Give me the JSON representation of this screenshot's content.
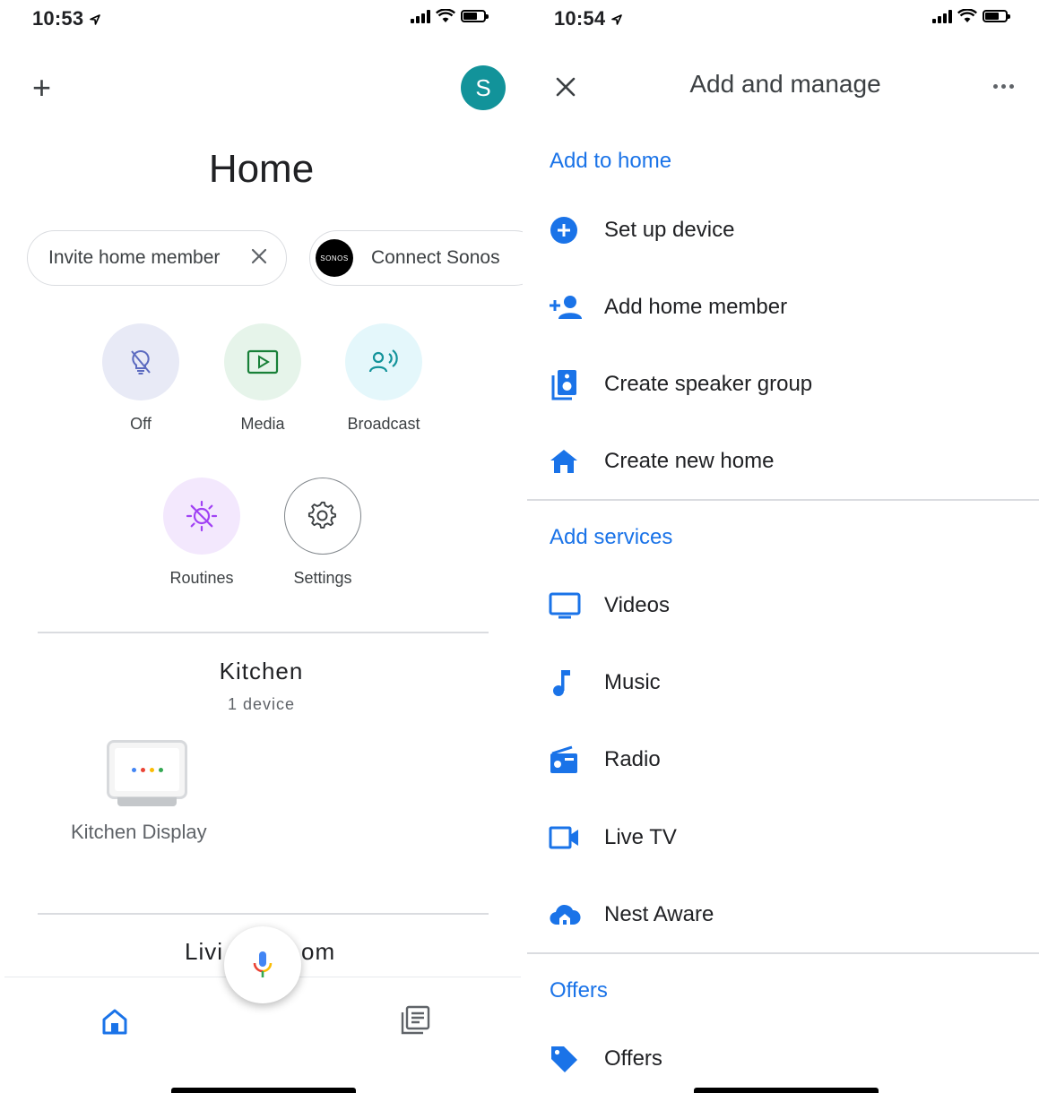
{
  "left": {
    "status": {
      "time": "10:53"
    },
    "avatar_letter": "S",
    "title": "Home",
    "chips": {
      "invite": "Invite home member",
      "sonos_logo": "SONOS",
      "sonos": "Connect Sonos"
    },
    "actions": {
      "off": "Off",
      "media": "Media",
      "broadcast": "Broadcast",
      "routines": "Routines",
      "settings": "Settings"
    },
    "room": {
      "name": "Kitchen",
      "count": "1 device",
      "device_name": "Kitchen Display"
    },
    "next_room": {
      "visible_left": "Livi",
      "visible_right": "om"
    }
  },
  "right": {
    "status": {
      "time": "10:54"
    },
    "title": "Add and manage",
    "sections": {
      "add_to_home": "Add to home",
      "add_services": "Add services",
      "offers": "Offers"
    },
    "items": {
      "setup_device": "Set up device",
      "add_member": "Add home member",
      "speaker_group": "Create speaker group",
      "new_home": "Create new home",
      "videos": "Videos",
      "music": "Music",
      "radio": "Radio",
      "live_tv": "Live TV",
      "nest_aware": "Nest Aware",
      "offers": "Offers"
    }
  },
  "colors": {
    "accent_blue": "#1a73e8",
    "avatar_teal": "#12939a",
    "off_bg": "#e8eaf6",
    "media_bg": "#e6f4ea",
    "broadcast_bg": "#e4f7fb",
    "routines_bg": "#f3e8fd"
  }
}
